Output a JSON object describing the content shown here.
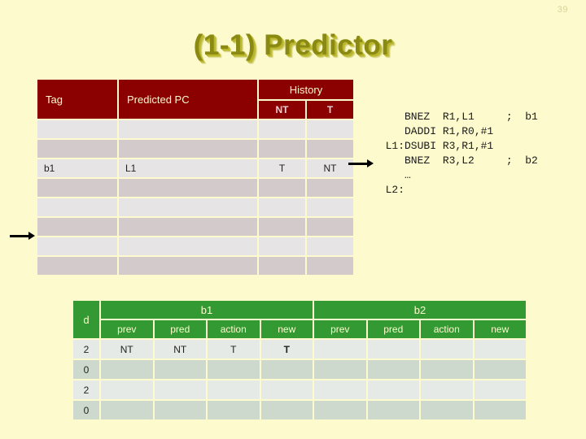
{
  "slide": {
    "number": "39",
    "title": "(1-1) Predictor"
  },
  "colors": {
    "background": "#fdfbcd",
    "title": "#8a8a12",
    "header_red": "#8b0000",
    "header_green": "#339933",
    "highlight_red": "#c00000"
  },
  "predictor_table": {
    "headers": {
      "tag": "Tag",
      "predicted_pc": "Predicted PC",
      "history": "History",
      "history_nt": "NT",
      "history_t": "T"
    },
    "rows": [
      {
        "tag": "",
        "predicted_pc": "",
        "nt": "",
        "t": ""
      },
      {
        "tag": "",
        "predicted_pc": "",
        "nt": "",
        "t": ""
      },
      {
        "tag": "b1",
        "predicted_pc": "L1",
        "nt": "T",
        "t": "NT"
      },
      {
        "tag": "",
        "predicted_pc": "",
        "nt": "",
        "t": ""
      },
      {
        "tag": "",
        "predicted_pc": "",
        "nt": "",
        "t": ""
      },
      {
        "tag": "",
        "predicted_pc": "",
        "nt": "",
        "t": ""
      },
      {
        "tag": "",
        "predicted_pc": "",
        "nt": "",
        "t": ""
      },
      {
        "tag": "",
        "predicted_pc": "",
        "nt": "",
        "t": ""
      }
    ]
  },
  "code": {
    "listing": "     BNEZ  R1,L1     ;  b1\n     DADDI R1,R0,#1\n  L1:DSUBI R3,R1,#1\n     BNEZ  R3,L2     ;  b2\n     …\n  L2:"
  },
  "arrows": {
    "left_arrow": "arrow-right-glyph",
    "code_arrow": "arrow-right-glyph"
  },
  "trace_table": {
    "headers": {
      "d": "d",
      "b1": "b1",
      "b2": "b2",
      "sub": [
        "prev",
        "pred",
        "action",
        "new"
      ]
    },
    "rows": [
      {
        "d": "2",
        "b1": {
          "prev": "NT",
          "pred": "NT",
          "action": "T",
          "new": "T",
          "new_highlight": true
        },
        "b2": {
          "prev": "",
          "pred": "",
          "action": "",
          "new": ""
        }
      },
      {
        "d": "0",
        "b1": {
          "prev": "",
          "pred": "",
          "action": "",
          "new": "",
          "new_highlight": false
        },
        "b2": {
          "prev": "",
          "pred": "",
          "action": "",
          "new": ""
        }
      },
      {
        "d": "2",
        "b1": {
          "prev": "",
          "pred": "",
          "action": "",
          "new": "",
          "new_highlight": false
        },
        "b2": {
          "prev": "",
          "pred": "",
          "action": "",
          "new": ""
        }
      },
      {
        "d": "0",
        "b1": {
          "prev": "",
          "pred": "",
          "action": "",
          "new": "",
          "new_highlight": false
        },
        "b2": {
          "prev": "",
          "pred": "",
          "action": "",
          "new": ""
        }
      }
    ]
  }
}
